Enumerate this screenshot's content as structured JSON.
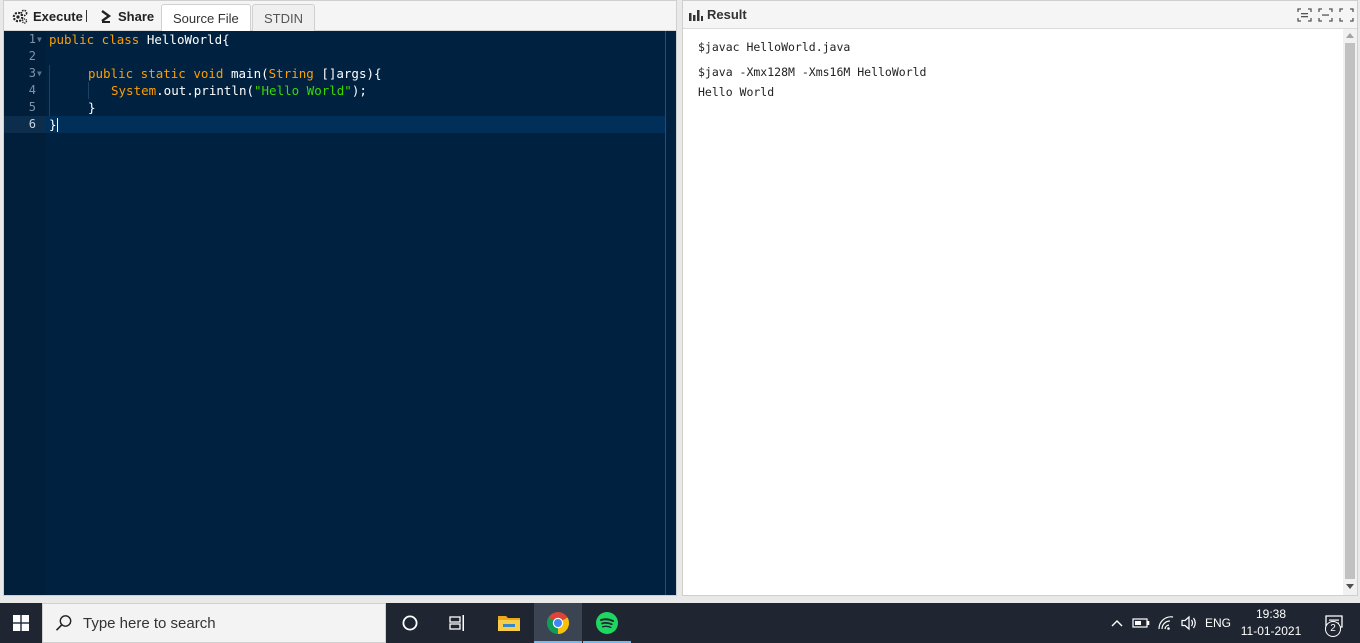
{
  "toolbar": {
    "execute_label": "Execute",
    "share_label": "Share",
    "tabs": [
      {
        "label": "Source File",
        "active": true
      },
      {
        "label": "STDIN",
        "active": false
      }
    ]
  },
  "editor": {
    "line_numbers": [
      "1",
      "2",
      "3",
      "4",
      "5",
      "6"
    ],
    "lines": {
      "l1_kw": "public class ",
      "l1_rest": "HelloWorld{",
      "l3_kw": "public static void ",
      "l3_rest": "main(",
      "l3_type": "String",
      "l3_rest2": " []args){",
      "l4_a": "System",
      "l4_b": ".out.println(",
      "l4_str": "\"Hello World\"",
      "l4_c": ");",
      "l5": "}",
      "l6": "}"
    },
    "colors": {
      "background": "#002240",
      "keyword": "#ff9d00",
      "string": "#3ad900"
    }
  },
  "result": {
    "title": "Result",
    "output": [
      "$javac HelloWorld.java",
      "$java -Xmx128M -Xms16M HelloWorld",
      "Hello World"
    ]
  },
  "taskbar": {
    "search_placeholder": "Type here to search",
    "apps": [
      "cortana-icon",
      "task-view-icon",
      "file-explorer-icon",
      "chrome-icon",
      "spotify-icon"
    ],
    "language": "ENG",
    "time": "19:38",
    "date": "11-01-2021",
    "notification_count": "2"
  }
}
